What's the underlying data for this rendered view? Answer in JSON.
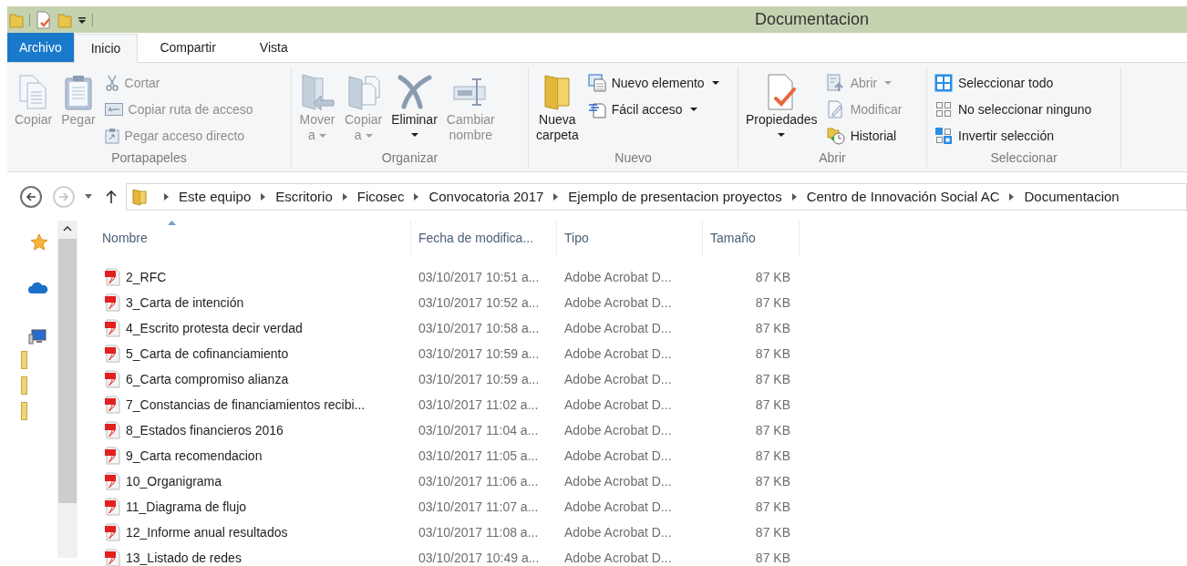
{
  "window": {
    "title": "Documentacion"
  },
  "tabs": [
    {
      "label": "Archivo",
      "kind": "file",
      "selected": false
    },
    {
      "label": "Inicio",
      "kind": "tab",
      "selected": true
    },
    {
      "label": "Compartir",
      "kind": "tab",
      "selected": false
    },
    {
      "label": "Vista",
      "kind": "tab",
      "selected": false
    }
  ],
  "ribbon": {
    "groups": [
      {
        "label": "Portapapeles",
        "commands": [
          {
            "label": "Copiar",
            "kind": "large",
            "disabled": true
          },
          {
            "label": "Pegar",
            "kind": "large",
            "disabled": true
          },
          {
            "label": "Cortar",
            "kind": "small",
            "disabled": true
          },
          {
            "label": "Copiar ruta de acceso",
            "kind": "small",
            "disabled": true
          },
          {
            "label": "Pegar acceso directo",
            "kind": "small",
            "disabled": true
          }
        ]
      },
      {
        "label": "Organizar",
        "commands": [
          {
            "label": "Mover a",
            "kind": "large",
            "disabled": true,
            "dropdown": true
          },
          {
            "label": "Copiar a",
            "kind": "large",
            "disabled": true,
            "dropdown": true
          },
          {
            "label": "Eliminar",
            "kind": "split",
            "disabled": false,
            "dropdown": true
          },
          {
            "label": "Cambiar nombre",
            "kind": "large",
            "disabled": true
          }
        ]
      },
      {
        "label": "Nuevo",
        "commands": [
          {
            "label": "Nueva carpeta",
            "kind": "large",
            "disabled": false
          },
          {
            "label": "Nuevo elemento",
            "kind": "small",
            "disabled": false,
            "dropdown": true
          },
          {
            "label": "Fácil acceso",
            "kind": "small",
            "disabled": false,
            "dropdown": true
          }
        ]
      },
      {
        "label": "Abrir",
        "commands": [
          {
            "label": "Propiedades",
            "kind": "split",
            "disabled": false,
            "dropdown": true
          },
          {
            "label": "Abrir",
            "kind": "small",
            "disabled": true,
            "dropdown": true
          },
          {
            "label": "Modificar",
            "kind": "small",
            "disabled": true
          },
          {
            "label": "Historial",
            "kind": "small",
            "disabled": false
          }
        ]
      },
      {
        "label": "Seleccionar",
        "commands": [
          {
            "label": "Seleccionar todo",
            "kind": "small",
            "disabled": false
          },
          {
            "label": "No seleccionar ninguno",
            "kind": "small",
            "disabled": false
          },
          {
            "label": "Invertir selección",
            "kind": "small",
            "disabled": false
          }
        ]
      }
    ]
  },
  "navigation": {
    "back_disabled": false,
    "forward_disabled": true
  },
  "breadcrumb": [
    "Este equipo",
    "Escritorio",
    "Ficosec",
    "Convocatoria 2017",
    "Ejemplo de presentacion proyectos",
    "Centro de Innovación Social AC",
    "Documentacion"
  ],
  "table": {
    "columns": [
      {
        "label": "Nombre",
        "sorted": true
      },
      {
        "label": "Fecha de modifica...",
        "sorted": false
      },
      {
        "label": "Tipo",
        "sorted": false
      },
      {
        "label": "Tamaño",
        "sorted": false
      }
    ],
    "rows": [
      {
        "name": "2_RFC",
        "date": "03/10/2017 10:51 a...",
        "type": "Adobe Acrobat D...",
        "size": "87 KB"
      },
      {
        "name": "3_Carta de intención",
        "date": "03/10/2017 10:52 a...",
        "type": "Adobe Acrobat D...",
        "size": "87 KB"
      },
      {
        "name": "4_Escrito protesta decir verdad",
        "date": "03/10/2017 10:58 a...",
        "type": "Adobe Acrobat D...",
        "size": "87 KB"
      },
      {
        "name": "5_Carta de cofinanciamiento",
        "date": "03/10/2017 10:59 a...",
        "type": "Adobe Acrobat D...",
        "size": "87 KB"
      },
      {
        "name": "6_Carta compromiso alianza",
        "date": "03/10/2017 10:59 a...",
        "type": "Adobe Acrobat D...",
        "size": "87 KB"
      },
      {
        "name": "7_Constancias de financiamientos recibi...",
        "date": "03/10/2017 11:02 a...",
        "type": "Adobe Acrobat D...",
        "size": "87 KB"
      },
      {
        "name": "8_Estados financieros 2016",
        "date": "03/10/2017 11:04 a...",
        "type": "Adobe Acrobat D...",
        "size": "87 KB"
      },
      {
        "name": "9_Carta recomendacion",
        "date": "03/10/2017 11:05 a...",
        "type": "Adobe Acrobat D...",
        "size": "87 KB"
      },
      {
        "name": "10_Organigrama",
        "date": "03/10/2017 11:06 a...",
        "type": "Adobe Acrobat D...",
        "size": "87 KB"
      },
      {
        "name": "11_Diagrama de flujo",
        "date": "03/10/2017 11:07 a...",
        "type": "Adobe Acrobat D...",
        "size": "87 KB"
      },
      {
        "name": "12_Informe anual resultados",
        "date": "03/10/2017 11:08 a...",
        "type": "Adobe Acrobat D...",
        "size": "87 KB"
      },
      {
        "name": "13_Listado de redes",
        "date": "03/10/2017 10:49 a...",
        "type": "Adobe Acrobat D...",
        "size": "87 KB"
      }
    ]
  }
}
